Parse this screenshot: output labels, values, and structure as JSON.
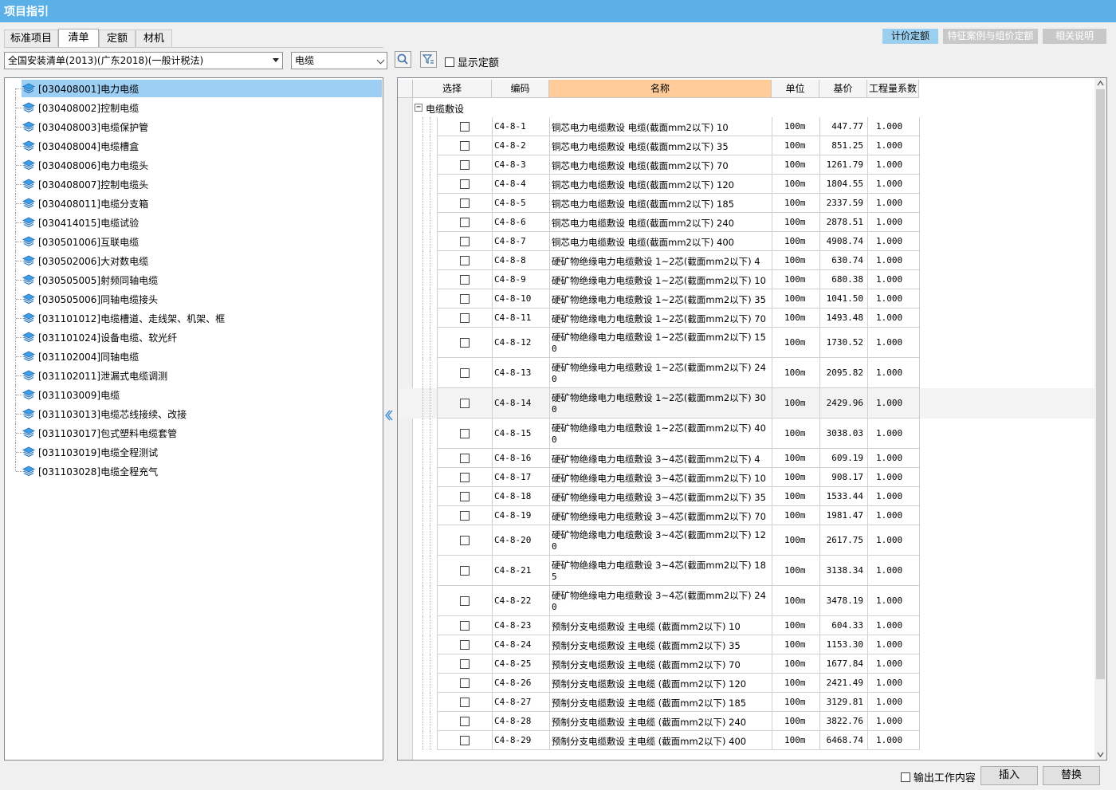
{
  "window": {
    "title": "项目指引"
  },
  "tabs": [
    {
      "label": "标准项目"
    },
    {
      "label": "清单"
    },
    {
      "label": "定额"
    },
    {
      "label": "材机"
    }
  ],
  "active_tab": 1,
  "right_buttons": [
    {
      "label": "计价定额"
    },
    {
      "label": "特征案例与组价定额"
    },
    {
      "label": "相关说明"
    }
  ],
  "filter": {
    "library": "全国安装清单(2013)(广东2018)(一般计税法)",
    "keyword": "电缆",
    "show_quota_label": "显示定额"
  },
  "tree": {
    "items": [
      {
        "label": "[030408001]电力电缆"
      },
      {
        "label": "[030408002]控制电缆"
      },
      {
        "label": "[030408003]电缆保护管"
      },
      {
        "label": "[030408004]电缆槽盒"
      },
      {
        "label": "[030408006]电力电缆头"
      },
      {
        "label": "[030408007]控制电缆头"
      },
      {
        "label": "[030408011]电缆分支箱"
      },
      {
        "label": "[030414015]电缆试验"
      },
      {
        "label": "[030501006]互联电缆"
      },
      {
        "label": "[030502006]大对数电缆"
      },
      {
        "label": "[030505005]射频同轴电缆"
      },
      {
        "label": "[030505006]同轴电缆接头"
      },
      {
        "label": "[031101012]电缆槽道、走线架、机架、框"
      },
      {
        "label": "[031101024]设备电缆、软光纤"
      },
      {
        "label": "[031102004]同轴电缆"
      },
      {
        "label": "[031102011]泄漏式电缆调测"
      },
      {
        "label": "[031103009]电缆"
      },
      {
        "label": "[031103013]电缆芯线接续、改接"
      },
      {
        "label": "[031103017]包式塑料电缆套管"
      },
      {
        "label": "[031103019]电缆全程测试"
      },
      {
        "label": "[031103028]电缆全程充气"
      }
    ]
  },
  "grid": {
    "headers": [
      "选择",
      "编码",
      "名称",
      "单位",
      "基价",
      "工程量系数"
    ],
    "group_label": "电缆敷设",
    "group_toggle": "−",
    "rows": [
      {
        "code": "C4-8-1",
        "name": "铜芯电力电缆敷设 电缆(截面mm2以下) 10",
        "name2": "",
        "unit": "100m",
        "price": "447.77",
        "coef": "1.000"
      },
      {
        "code": "C4-8-2",
        "name": "铜芯电力电缆敷设 电缆(截面mm2以下) 35",
        "name2": "",
        "unit": "100m",
        "price": "851.25",
        "coef": "1.000"
      },
      {
        "code": "C4-8-3",
        "name": "铜芯电力电缆敷设 电缆(截面mm2以下) 70",
        "name2": "",
        "unit": "100m",
        "price": "1261.79",
        "coef": "1.000"
      },
      {
        "code": "C4-8-4",
        "name": "铜芯电力电缆敷设 电缆(截面mm2以下) 120",
        "name2": "",
        "unit": "100m",
        "price": "1804.55",
        "coef": "1.000"
      },
      {
        "code": "C4-8-5",
        "name": "铜芯电力电缆敷设 电缆(截面mm2以下) 185",
        "name2": "",
        "unit": "100m",
        "price": "2337.59",
        "coef": "1.000"
      },
      {
        "code": "C4-8-6",
        "name": "铜芯电力电缆敷设 电缆(截面mm2以下) 240",
        "name2": "",
        "unit": "100m",
        "price": "2878.51",
        "coef": "1.000"
      },
      {
        "code": "C4-8-7",
        "name": "铜芯电力电缆敷设 电缆(截面mm2以下) 400",
        "name2": "",
        "unit": "100m",
        "price": "4908.74",
        "coef": "1.000"
      },
      {
        "code": "C4-8-8",
        "name": "硬矿物绝缘电力电缆敷设 1~2芯(截面mm2以下) 4",
        "name2": "",
        "unit": "100m",
        "price": "630.74",
        "coef": "1.000"
      },
      {
        "code": "C4-8-9",
        "name": "硬矿物绝缘电力电缆敷设 1~2芯(截面mm2以下) 10",
        "name2": "",
        "unit": "100m",
        "price": "680.38",
        "coef": "1.000"
      },
      {
        "code": "C4-8-10",
        "name": "硬矿物绝缘电力电缆敷设 1~2芯(截面mm2以下) 35",
        "name2": "",
        "unit": "100m",
        "price": "1041.50",
        "coef": "1.000"
      },
      {
        "code": "C4-8-11",
        "name": "硬矿物绝缘电力电缆敷设 1~2芯(截面mm2以下) 70",
        "name2": "",
        "unit": "100m",
        "price": "1493.48",
        "coef": "1.000"
      },
      {
        "code": "C4-8-12",
        "name": "硬矿物绝缘电力电缆敷设 1~2芯(截面mm2以下) 15",
        "name2": "0",
        "unit": "100m",
        "price": "1730.52",
        "coef": "1.000"
      },
      {
        "code": "C4-8-13",
        "name": "硬矿物绝缘电力电缆敷设 1~2芯(截面mm2以下) 24",
        "name2": "0",
        "unit": "100m",
        "price": "2095.82",
        "coef": "1.000"
      },
      {
        "code": "C4-8-14",
        "name": "硬矿物绝缘电力电缆敷设 1~2芯(截面mm2以下) 30",
        "name2": "0",
        "unit": "100m",
        "price": "2429.96",
        "coef": "1.000"
      },
      {
        "code": "C4-8-15",
        "name": "硬矿物绝缘电力电缆敷设 1~2芯(截面mm2以下) 40",
        "name2": "0",
        "unit": "100m",
        "price": "3038.03",
        "coef": "1.000"
      },
      {
        "code": "C4-8-16",
        "name": "硬矿物绝缘电力电缆敷设 3~4芯(截面mm2以下) 4",
        "name2": "",
        "unit": "100m",
        "price": "609.19",
        "coef": "1.000"
      },
      {
        "code": "C4-8-17",
        "name": "硬矿物绝缘电力电缆敷设 3~4芯(截面mm2以下) 10",
        "name2": "",
        "unit": "100m",
        "price": "908.17",
        "coef": "1.000"
      },
      {
        "code": "C4-8-18",
        "name": "硬矿物绝缘电力电缆敷设 3~4芯(截面mm2以下) 35",
        "name2": "",
        "unit": "100m",
        "price": "1533.44",
        "coef": "1.000"
      },
      {
        "code": "C4-8-19",
        "name": "硬矿物绝缘电力电缆敷设 3~4芯(截面mm2以下) 70",
        "name2": "",
        "unit": "100m",
        "price": "1981.47",
        "coef": "1.000"
      },
      {
        "code": "C4-8-20",
        "name": "硬矿物绝缘电力电缆敷设 3~4芯(截面mm2以下) 12",
        "name2": "0",
        "unit": "100m",
        "price": "2617.75",
        "coef": "1.000"
      },
      {
        "code": "C4-8-21",
        "name": "硬矿物绝缘电力电缆敷设 3~4芯(截面mm2以下) 18",
        "name2": "5",
        "unit": "100m",
        "price": "3138.34",
        "coef": "1.000"
      },
      {
        "code": "C4-8-22",
        "name": "硬矿物绝缘电力电缆敷设 3~4芯(截面mm2以下) 24",
        "name2": "0",
        "unit": "100m",
        "price": "3478.19",
        "coef": "1.000"
      },
      {
        "code": "C4-8-23",
        "name": "预制分支电缆敷设 主电缆 (截面mm2以下)  10",
        "name2": "",
        "unit": "100m",
        "price": "604.33",
        "coef": "1.000"
      },
      {
        "code": "C4-8-24",
        "name": "预制分支电缆敷设 主电缆 (截面mm2以下)  35",
        "name2": "",
        "unit": "100m",
        "price": "1153.30",
        "coef": "1.000"
      },
      {
        "code": "C4-8-25",
        "name": "预制分支电缆敷设 主电缆 (截面mm2以下)  70",
        "name2": "",
        "unit": "100m",
        "price": "1677.84",
        "coef": "1.000"
      },
      {
        "code": "C4-8-26",
        "name": "预制分支电缆敷设 主电缆 (截面mm2以下)  120",
        "name2": "",
        "unit": "100m",
        "price": "2421.49",
        "coef": "1.000"
      },
      {
        "code": "C4-8-27",
        "name": "预制分支电缆敷设 主电缆 (截面mm2以下)  185",
        "name2": "",
        "unit": "100m",
        "price": "3129.81",
        "coef": "1.000"
      },
      {
        "code": "C4-8-28",
        "name": "预制分支电缆敷设 主电缆 (截面mm2以下)  240",
        "name2": "",
        "unit": "100m",
        "price": "3822.76",
        "coef": "1.000"
      },
      {
        "code": "C4-8-29",
        "name": "预制分支电缆敷设 主电缆 (截面mm2以下)  400",
        "name2": "",
        "unit": "100m",
        "price": "6468.74",
        "coef": "1.000"
      }
    ]
  },
  "bottom": {
    "output_label": "输出工作内容",
    "insert_label": "插入",
    "replace_label": "替换"
  },
  "colors": {
    "titlebar": "#5ab0e7",
    "selection": "#9dcef4",
    "header_highlight": "#ffcc99",
    "active_button": "#9acfef"
  }
}
